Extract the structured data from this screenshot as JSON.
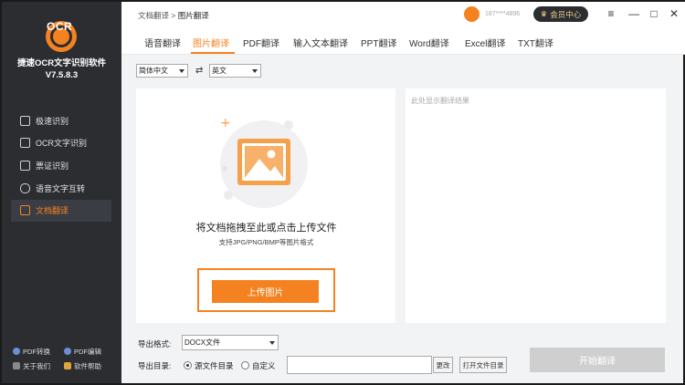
{
  "app": {
    "logo_text": "OCR",
    "name_line1": "捷速OCR文字识别软件",
    "name_line2": "V7.5.8.3",
    "accent_color": "#f58220"
  },
  "sidebar": {
    "items": [
      {
        "label": "极速识别",
        "icon": "lightning-icon"
      },
      {
        "label": "OCR文字识别",
        "icon": "scan-icon"
      },
      {
        "label": "票证识别",
        "icon": "ticket-icon"
      },
      {
        "label": "语音文字互转",
        "icon": "microphone-icon"
      },
      {
        "label": "文档翻译",
        "icon": "translate-icon",
        "active": true
      }
    ],
    "tools": [
      {
        "label": "PDF转换",
        "icon": "pdf-convert-icon"
      },
      {
        "label": "PDF编辑",
        "icon": "pdf-edit-icon"
      },
      {
        "label": "关于我们",
        "icon": "info-icon"
      },
      {
        "label": "软件帮助",
        "icon": "help-icon"
      }
    ]
  },
  "topbar": {
    "breadcrumb_parent": "文档翻译",
    "breadcrumb_sep": ">",
    "breadcrumb_current": "图片翻译",
    "user_id": "187****4896",
    "vip_label": "会员中心"
  },
  "tabs": [
    "语音翻译",
    "图片翻译",
    "PDF翻译",
    "输入文本翻译",
    "PPT翻译",
    "Word翻译",
    "Excel翻译",
    "TXT翻译"
  ],
  "active_tab": 1,
  "languages": {
    "source": "简体中文",
    "swap_symbol": "⇄",
    "target": "英文"
  },
  "drop_area": {
    "title": "将文档拖拽至此或点击上传文件",
    "subtitle": "支持JPG/PNG/BMP等图片格式",
    "upload_label": "上传图片"
  },
  "result_area": {
    "placeholder": "此处显示翻译结果"
  },
  "export": {
    "format_label": "导出格式:",
    "format_value": "DOCX文件",
    "dir_label": "导出目录:",
    "option_source": "源文件目录",
    "option_custom": "自定义",
    "change_label": "更改",
    "open_folder_label": "打开文件目录",
    "start_label": "开始翻译"
  }
}
